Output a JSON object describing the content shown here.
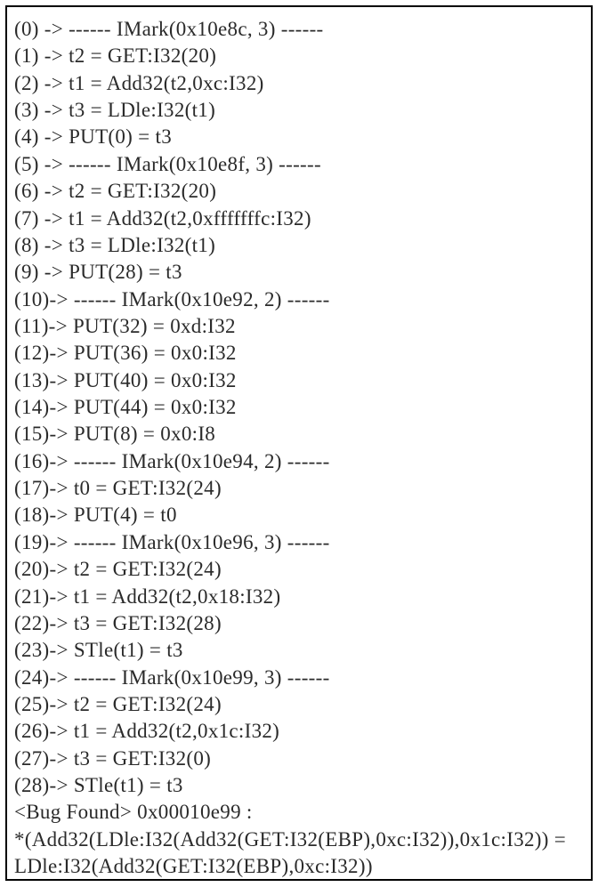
{
  "rows": [
    {
      "idx": "(0) ",
      "arrow": "-> ",
      "body": "------ IMark(0x10e8c, 3) ------"
    },
    {
      "idx": "(1) ",
      "arrow": "-> ",
      "body": "t2 = GET:I32(20)"
    },
    {
      "idx": "(2) ",
      "arrow": "-> ",
      "body": "t1 = Add32(t2,0xc:I32)"
    },
    {
      "idx": "(3) ",
      "arrow": "-> ",
      "body": "t3 = LDle:I32(t1)"
    },
    {
      "idx": "(4) ",
      "arrow": "-> ",
      "body": "PUT(0) = t3"
    },
    {
      "idx": "(5) ",
      "arrow": "-> ",
      "body": "------ IMark(0x10e8f, 3) ------"
    },
    {
      "idx": "(6) ",
      "arrow": "-> ",
      "body": "t2 = GET:I32(20)"
    },
    {
      "idx": "(7) ",
      "arrow": "-> ",
      "body": "t1 = Add32(t2,0xfffffffc:I32)"
    },
    {
      "idx": "(8) ",
      "arrow": "-> ",
      "body": "t3 = LDle:I32(t1)"
    },
    {
      "idx": "(9) ",
      "arrow": "-> ",
      "body": "PUT(28) = t3"
    },
    {
      "idx": "(10)",
      "arrow": "-> ",
      "body": "------ IMark(0x10e92, 2) ------"
    },
    {
      "idx": "(11)",
      "arrow": "-> ",
      "body": "PUT(32) = 0xd:I32"
    },
    {
      "idx": "(12)",
      "arrow": "-> ",
      "body": "PUT(36) = 0x0:I32"
    },
    {
      "idx": "(13)",
      "arrow": "-> ",
      "body": "PUT(40) = 0x0:I32"
    },
    {
      "idx": "(14)",
      "arrow": "-> ",
      "body": "PUT(44) = 0x0:I32"
    },
    {
      "idx": "(15)",
      "arrow": "-> ",
      "body": "PUT(8) = 0x0:I8"
    },
    {
      "idx": "(16)",
      "arrow": "-> ",
      "body": "------ IMark(0x10e94, 2) ------"
    },
    {
      "idx": "(17)",
      "arrow": "-> ",
      "body": "t0 = GET:I32(24)"
    },
    {
      "idx": "(18)",
      "arrow": "-> ",
      "body": "PUT(4) = t0"
    },
    {
      "idx": "(19)",
      "arrow": "-> ",
      "body": "------ IMark(0x10e96, 3) ------"
    },
    {
      "idx": "(20)",
      "arrow": "-> ",
      "body": "t2 = GET:I32(24)"
    },
    {
      "idx": "(21)",
      "arrow": "-> ",
      "body": "t1 = Add32(t2,0x18:I32)"
    },
    {
      "idx": "(22)",
      "arrow": "-> ",
      "body": "t3 = GET:I32(28)"
    },
    {
      "idx": "(23)",
      "arrow": "-> ",
      "body": "STle(t1) = t3"
    },
    {
      "idx": "(24)",
      "arrow": "-> ",
      "body": "------ IMark(0x10e99, 3) ------"
    },
    {
      "idx": "(25)",
      "arrow": "-> ",
      "body": "t2 = GET:I32(24)"
    },
    {
      "idx": "(26)",
      "arrow": "-> ",
      "body": "t1 = Add32(t2,0x1c:I32)"
    },
    {
      "idx": "(27)",
      "arrow": "-> ",
      "body": "t3 = GET:I32(0)"
    },
    {
      "idx": "(28)",
      "arrow": "-> ",
      "body": "STle(t1) = t3"
    }
  ],
  "bug_header": "<Bug Found> 0x00010e99 :",
  "bug_expr": "*(Add32(LDle:I32(Add32(GET:I32(EBP),0xc:I32)),0x1c:I32)) = LDle:I32(Add32(GET:I32(EBP),0xc:I32))"
}
